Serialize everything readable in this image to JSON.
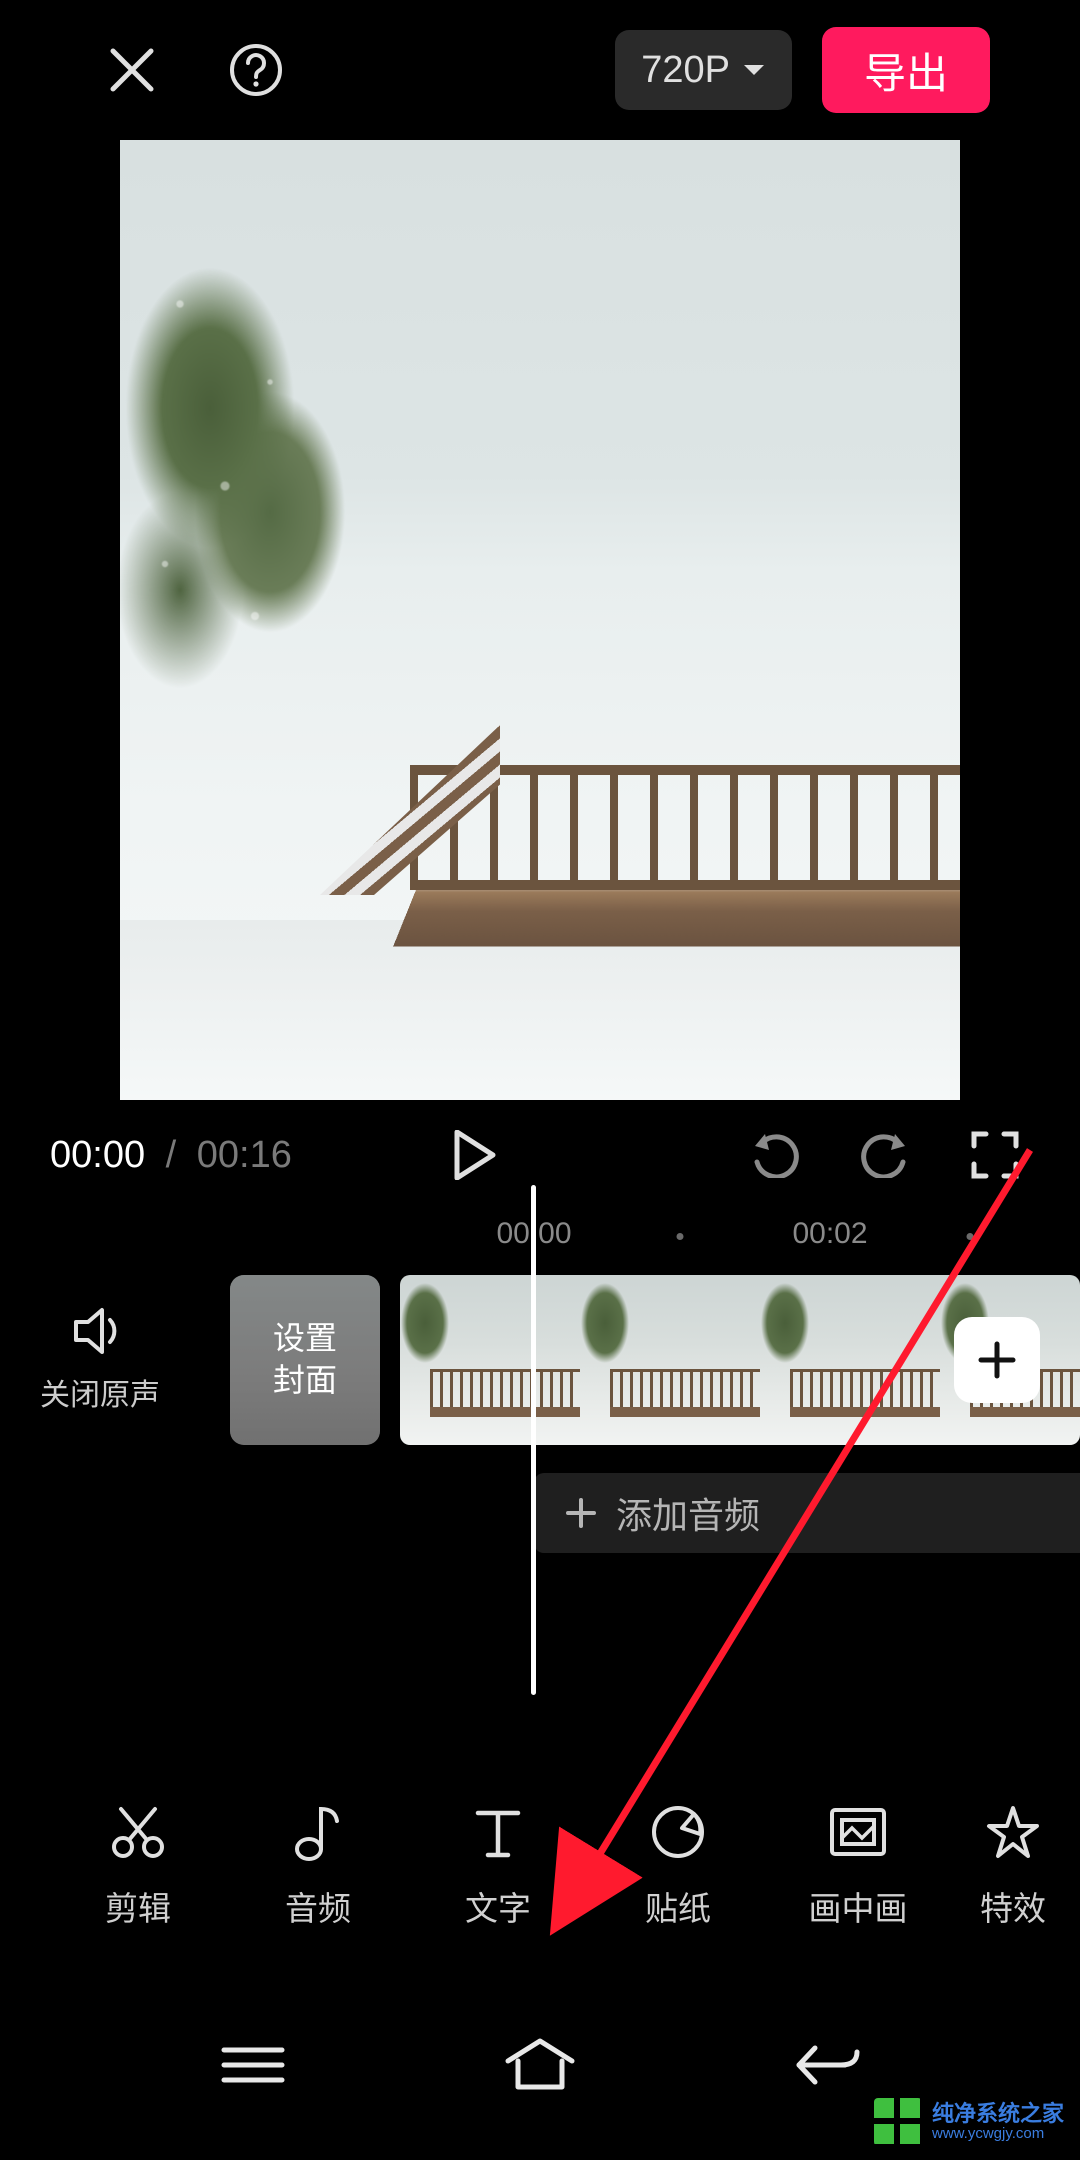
{
  "header": {
    "resolution": "720P",
    "export_label": "导出"
  },
  "playback": {
    "current": "00:00",
    "total": "00:16"
  },
  "ruler": {
    "marks": [
      "00:00",
      "00:02"
    ]
  },
  "timeline": {
    "mute_label": "关闭原声",
    "cover_line1": "设置",
    "cover_line2": "封面",
    "add_audio_label": "添加音频"
  },
  "toolbar": {
    "items": [
      {
        "label": "剪辑",
        "icon": "scissors"
      },
      {
        "label": "音频",
        "icon": "note"
      },
      {
        "label": "文字",
        "icon": "text"
      },
      {
        "label": "贴纸",
        "icon": "sticker"
      },
      {
        "label": "画中画",
        "icon": "pip"
      },
      {
        "label": "特效",
        "icon": "star"
      }
    ]
  },
  "watermark": {
    "title": "纯净系统之家",
    "url": "www.ycwgjy.com"
  }
}
